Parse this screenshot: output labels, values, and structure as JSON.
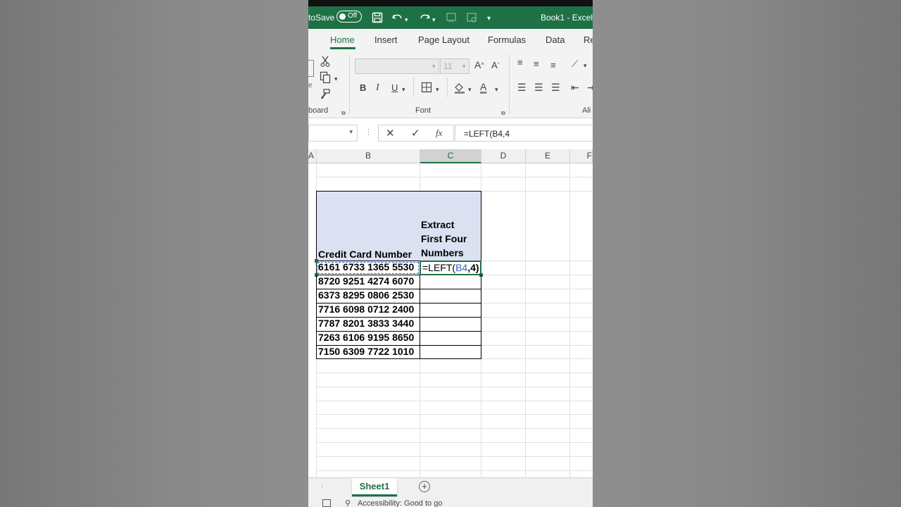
{
  "window": {
    "autosave_label": "toSave",
    "toggle_label": "Off",
    "title": "Book1  -  Excel"
  },
  "tabs": [
    {
      "label": "Home",
      "active": true
    },
    {
      "label": "Insert"
    },
    {
      "label": "Page Layout"
    },
    {
      "label": "Formulas"
    },
    {
      "label": "Data"
    },
    {
      "label": "Re"
    }
  ],
  "ribbon": {
    "clipboard_label": "board",
    "font_label": "Font",
    "align_label": "Ali",
    "font_size": "11",
    "clipboard_edge": "e"
  },
  "formula_bar": {
    "formula": "=LEFT(B4,4"
  },
  "columns": [
    "A",
    "B",
    "C",
    "D",
    "E",
    "F"
  ],
  "sheet": {
    "header_b": "Credit Card Number",
    "header_c_lines": [
      "Extract",
      "First Four",
      "Numbers"
    ],
    "rows": [
      "6161 6733 1365 5530",
      "8720 9251 4274 6070",
      "6373 8295 0806 2530",
      "7716 6098 0712 2400",
      "7787 8201 3833 3440",
      "7263 6106 9195 8650",
      "7150 6309 7722 1010"
    ],
    "editing": {
      "prefix": "=LEFT(",
      "ref": "B4",
      "suffix": ",4)"
    }
  },
  "sheet_tabs": [
    {
      "label": "Sheet1",
      "active": true
    }
  ],
  "status": {
    "accessibility": "Accessibility: Good to go"
  },
  "colors": {
    "accent": "#1e7145",
    "header_fill": "#dbe1f0",
    "ref_blue": "#2b62c4"
  },
  "icons": [
    "save-icon",
    "undo-icon",
    "redo-icon",
    "cut-icon",
    "copy-icon",
    "format-painter-icon",
    "bold-icon",
    "italic-icon",
    "underline-icon",
    "borders-icon",
    "fill-color-icon",
    "font-color-icon",
    "cancel-icon",
    "enter-icon",
    "function-icon",
    "add-sheet-icon"
  ]
}
